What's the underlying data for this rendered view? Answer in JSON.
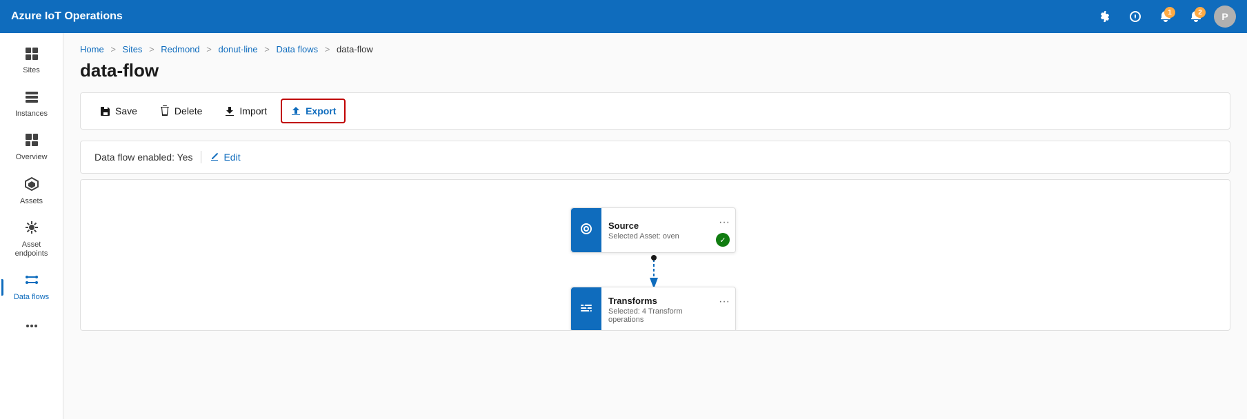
{
  "app": {
    "title": "Azure IoT Operations"
  },
  "topbar": {
    "title": "Azure IoT Operations",
    "icons": {
      "settings": "⚙",
      "help": "?",
      "bell1_badge": "1",
      "bell2_badge": "2",
      "avatar_label": "P"
    }
  },
  "sidebar": {
    "items": [
      {
        "id": "sites",
        "label": "Sites",
        "icon": "🏢",
        "active": false
      },
      {
        "id": "instances",
        "label": "Instances",
        "icon": "⊞",
        "active": false
      },
      {
        "id": "overview",
        "label": "Overview",
        "icon": "▦",
        "active": false
      },
      {
        "id": "assets",
        "label": "Assets",
        "icon": "◈",
        "active": false
      },
      {
        "id": "asset-endpoints",
        "label": "Asset endpoints",
        "icon": "✦",
        "active": false
      },
      {
        "id": "data-flows",
        "label": "Data flows",
        "icon": "⇄",
        "active": true
      }
    ]
  },
  "breadcrumb": {
    "items": [
      "Home",
      "Sites",
      "Redmond",
      "donut-line",
      "Data flows"
    ],
    "current": "data-flow"
  },
  "page": {
    "title": "data-flow"
  },
  "toolbar": {
    "save_label": "Save",
    "delete_label": "Delete",
    "import_label": "Import",
    "export_label": "Export"
  },
  "info_bar": {
    "enabled_label": "Data flow enabled: Yes",
    "edit_label": "Edit"
  },
  "flow": {
    "source_node": {
      "title": "Source",
      "subtitle": "Selected Asset: oven",
      "status": "✓"
    },
    "transforms_node": {
      "title": "Transforms",
      "subtitle": "Selected: 4 Transform operations"
    }
  }
}
